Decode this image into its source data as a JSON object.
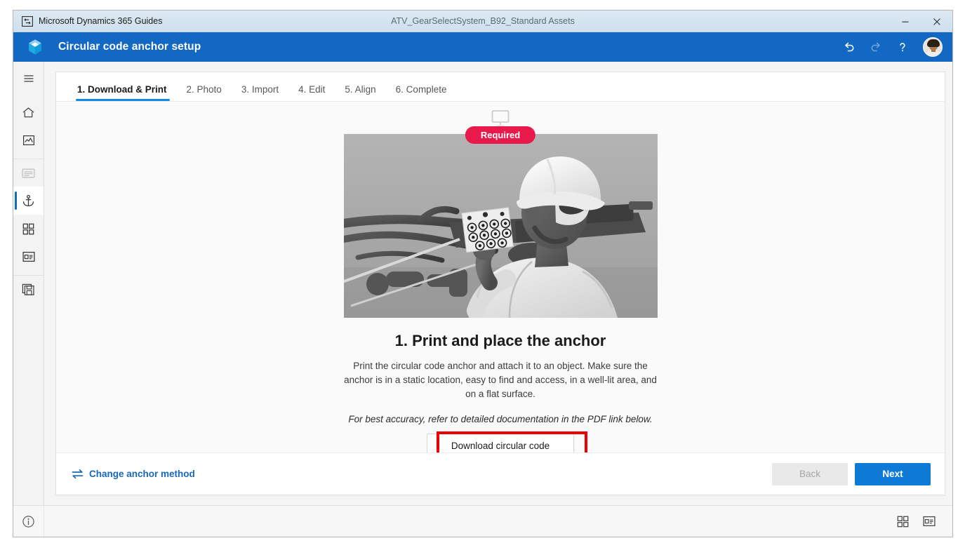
{
  "window": {
    "app_name": "Microsoft Dynamics 365 Guides",
    "document_title": "ATV_GearSelectSystem_B92_Standard Assets",
    "minimize_label": "—",
    "close_label": "✕",
    "app_icon": "guides-app-icon"
  },
  "appbar": {
    "title": "Circular code anchor setup",
    "logo_icon": "dynamics-365-guides-logo",
    "undo_icon": "undo-arrow-icon",
    "redo_icon": "redo-arrow-icon",
    "help_label": "?",
    "help_icon": "help-question-icon",
    "avatar_icon": "user-avatar"
  },
  "rail": {
    "items": [
      {
        "name": "menu-hamburger",
        "icon": "hamburger-menu-icon",
        "state": "default"
      },
      {
        "name": "home",
        "icon": "home-icon",
        "state": "default"
      },
      {
        "name": "analytics",
        "icon": "chart-image-icon",
        "state": "default"
      },
      {
        "name": "steps-outline",
        "icon": "text-lines-icon",
        "state": "disabled"
      },
      {
        "name": "anchor",
        "icon": "anchor-icon",
        "state": "active"
      },
      {
        "name": "apps-grid",
        "icon": "grid-four-squares-icon",
        "state": "default"
      },
      {
        "name": "card-layout",
        "icon": "card-details-icon",
        "state": "default"
      },
      {
        "name": "save-copies",
        "icon": "save-stack-icon",
        "state": "default"
      }
    ]
  },
  "tabs": [
    {
      "label": "1. Download & Print",
      "active": true
    },
    {
      "label": "2. Photo",
      "active": false
    },
    {
      "label": "3. Import",
      "active": false
    },
    {
      "label": "4. Edit",
      "active": false
    },
    {
      "label": "5. Align",
      "active": false
    },
    {
      "label": "6. Complete",
      "active": false
    }
  ],
  "content": {
    "device_icon": "desktop-monitor-icon",
    "badge": "Required",
    "badge_color": "#e8194b",
    "hero_alt": "Worker in hard hat placing a circular code marker on a vehicle frame",
    "step_title": "1. Print and place the anchor",
    "step_description": "Print the circular code anchor and attach it to an object. Make sure the anchor is in a static location, easy to find and access, in a well-lit area, and on a flat surface.",
    "step_note": "For best accuracy, refer to detailed documentation in the PDF link below.",
    "download_button": "Download circular code",
    "annotation_color": "#ee0000"
  },
  "footer": {
    "change_method_label": "Change anchor method",
    "change_method_icon": "swap-arrows-icon",
    "back_label": "Back",
    "back_disabled": true,
    "next_label": "Next",
    "next_color": "#0f7ad6"
  },
  "statusbar": {
    "info_icon": "info-circle-icon",
    "grid_icon": "grid-four-squares-icon",
    "card_icon": "card-details-icon"
  }
}
